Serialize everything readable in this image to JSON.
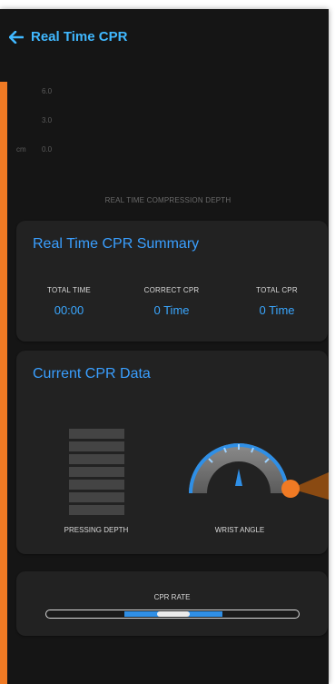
{
  "header": {
    "title": "Real Time CPR"
  },
  "depth_chart": {
    "ticks": [
      "6.0",
      "3.0",
      "0.0"
    ],
    "unit": "cm",
    "label": "REAL TIME COMPRESSION DEPTH"
  },
  "summary": {
    "title": "Real Time CPR Summary",
    "stats": [
      {
        "label": "TOTAL TIME",
        "value": "00:00"
      },
      {
        "label": "CORRECT CPR",
        "value": "0 Time"
      },
      {
        "label": "TOTAL CPR",
        "value": "0 Time"
      }
    ]
  },
  "current_data": {
    "title": "Current CPR Data",
    "pressing_label": "PRESSING DEPTH",
    "wrist_label": "WRIST ANGLE",
    "depth_segments": 7
  },
  "cpr_rate": {
    "label": "CPR RATE"
  },
  "colors": {
    "accent_orange": "#f07a24",
    "accent_blue": "#3a9fff",
    "card_bg": "#222222",
    "screen_bg": "#151515"
  },
  "icons": [
    "back-arrow-icon",
    "wrist-angle-gauge-icon"
  ]
}
